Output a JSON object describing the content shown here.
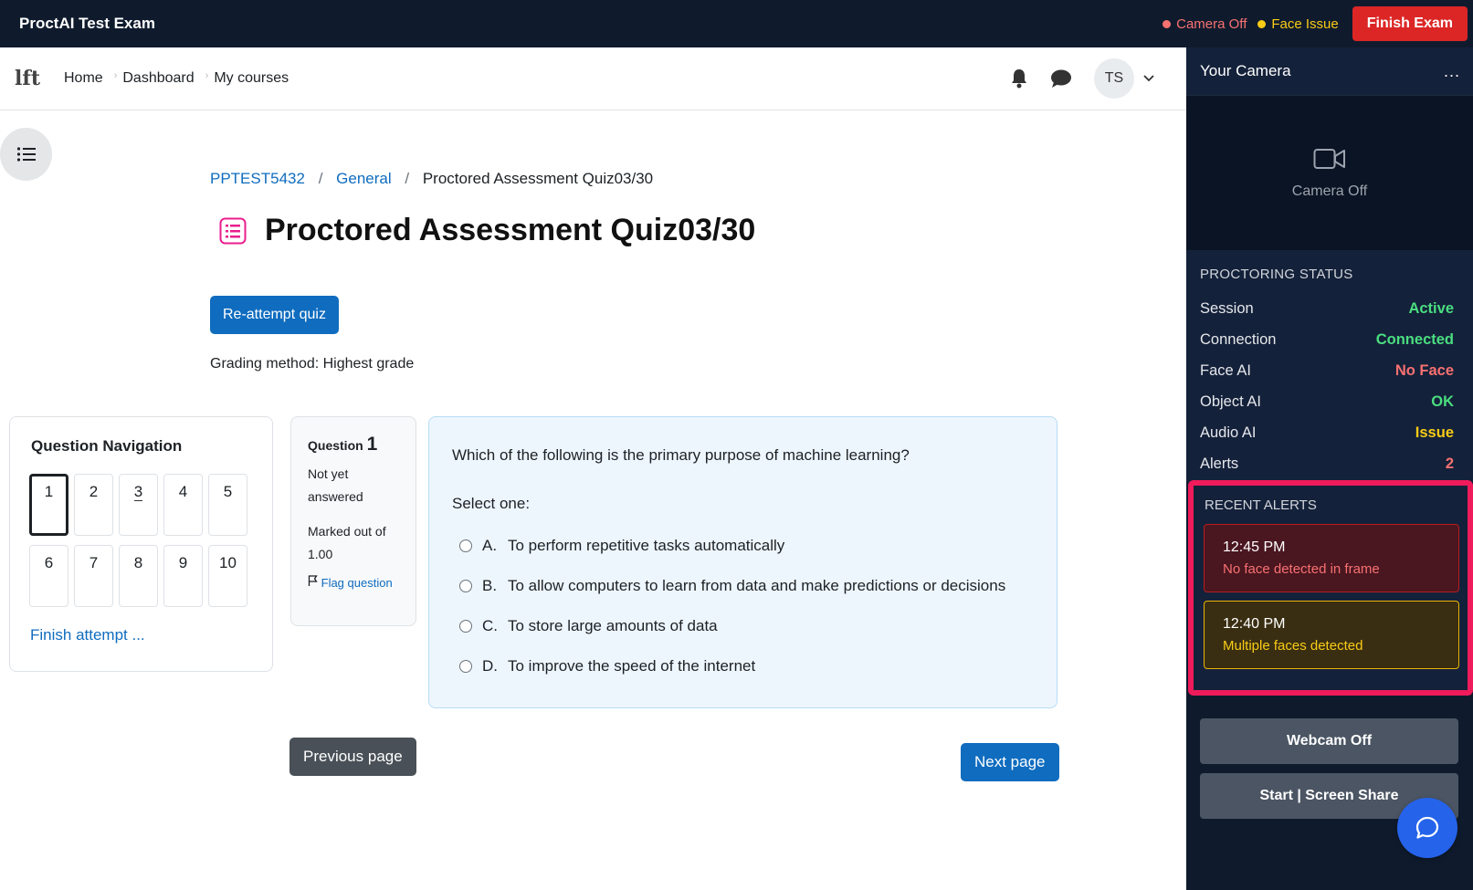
{
  "topbar": {
    "title": "ProctAI Test Exam",
    "camera_status": "Camera Off",
    "face_status": "Face Issue",
    "finish_label": "Finish Exam"
  },
  "navbar": {
    "logo": "lft",
    "links": [
      "Home",
      "Dashboard",
      "My courses"
    ],
    "avatar_initials": "TS"
  },
  "breadcrumb": {
    "items": [
      "PPTEST5432",
      "General",
      "Proctored Assessment Quiz03/30"
    ]
  },
  "page": {
    "title": "Proctored Assessment Quiz03/30",
    "reattempt_label": "Re-attempt quiz",
    "grading_method": "Grading method: Highest grade"
  },
  "question_nav": {
    "title": "Question Navigation",
    "numbers": [
      "1",
      "2",
      "3",
      "4",
      "5",
      "6",
      "7",
      "8",
      "9",
      "10"
    ],
    "current": "1",
    "finish_attempt": "Finish attempt ..."
  },
  "question_info": {
    "label": "Question",
    "number": "1",
    "status_line1": "Not yet",
    "status_line2": "answered",
    "marked_line1": "Marked out of",
    "marked_line2": "1.00",
    "flag_label": "Flag question"
  },
  "question": {
    "text": "Which of the following is the primary purpose of machine learning?",
    "select_label": "Select one:",
    "answers": [
      {
        "letter": "A.",
        "text": "To perform repetitive tasks automatically"
      },
      {
        "letter": "B.",
        "text": "To allow computers to learn from data and make predictions or decisions"
      },
      {
        "letter": "C.",
        "text": "To store large amounts of data"
      },
      {
        "letter": "D.",
        "text": "To improve the speed of the internet"
      }
    ]
  },
  "pagination": {
    "prev_label": "Previous page",
    "next_label": "Next page"
  },
  "sidebar": {
    "camera_title": "Your Camera",
    "more_icon": "...",
    "camera_off_label": "Camera Off",
    "status_title": "PROCTORING STATUS",
    "status_rows": [
      {
        "label": "Session",
        "value": "Active",
        "color": "#4ade80"
      },
      {
        "label": "Connection",
        "value": "Connected",
        "color": "#4ade80"
      },
      {
        "label": "Face AI",
        "value": "No Face",
        "color": "#f87171"
      },
      {
        "label": "Object AI",
        "value": "OK",
        "color": "#4ade80"
      },
      {
        "label": "Audio AI",
        "value": "Issue",
        "color": "#facc15"
      },
      {
        "label": "Alerts",
        "value": "2",
        "color": "#f87171"
      }
    ],
    "alerts_title": "RECENT ALERTS",
    "alerts": [
      {
        "time": "12:45 PM",
        "message": "No face detected in frame"
      },
      {
        "time": "12:40 PM",
        "message": "Multiple faces detected"
      }
    ],
    "webcam_label": "Webcam Off",
    "screen_share_label": "Start | Screen Share"
  },
  "colors": {
    "topbar_bg": "#0f1b2d",
    "accent_blue": "#0f6cbf",
    "danger": "#dc2626",
    "highlight_border": "#ef1b5b"
  }
}
